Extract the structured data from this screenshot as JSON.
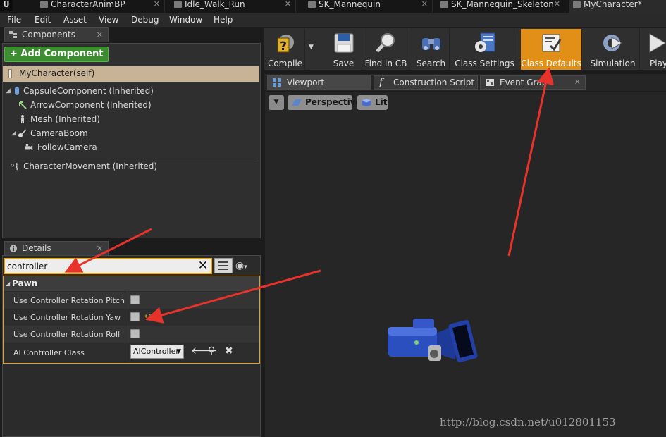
{
  "tabs": [
    {
      "label": "CharacterAnimBP"
    },
    {
      "label": "Idle_Walk_Run"
    },
    {
      "label": "SK_Mannequin"
    },
    {
      "label": "SK_Mannequin_Skeleton"
    },
    {
      "label": "MyCharacter*"
    }
  ],
  "menu": [
    "File",
    "Edit",
    "Asset",
    "View",
    "Debug",
    "Window",
    "Help"
  ],
  "components": {
    "tab_label": "Components",
    "add_button": "+ Add Component ▾",
    "self_item": "MyCharacter(self)",
    "tree": [
      {
        "label": "CapsuleComponent (Inherited)",
        "icon": "capsule-icon"
      },
      {
        "label": "ArrowComponent (Inherited)",
        "icon": "arrow-icon"
      },
      {
        "label": "Mesh (Inherited)",
        "icon": "mesh-icon"
      },
      {
        "label": "CameraBoom",
        "icon": "camera-boom-icon"
      },
      {
        "label": "FollowCamera",
        "icon": "camera-icon"
      },
      {
        "label": "CharacterMovement (Inherited)",
        "icon": "movement-icon"
      }
    ]
  },
  "details": {
    "tab_label": "Details",
    "search_value": "controller",
    "section": "Pawn",
    "properties": [
      {
        "label": "Use Controller Rotation Pitch",
        "checked": false
      },
      {
        "label": "Use Controller Rotation Yaw",
        "checked": false
      },
      {
        "label": "Use Controller Rotation Roll",
        "checked": false
      }
    ],
    "ai_controller": {
      "label": "AI Controller Class",
      "value": "AIController"
    }
  },
  "toolbar": {
    "buttons": [
      {
        "label": "Compile",
        "icon": "compile-icon"
      },
      {
        "label": "Save",
        "icon": "save-icon"
      },
      {
        "label": "Find in CB",
        "icon": "find-icon"
      },
      {
        "label": "Search",
        "icon": "binoculars-icon"
      },
      {
        "label": "Class Settings",
        "icon": "class-settings-icon"
      },
      {
        "label": "Class Defaults",
        "icon": "class-defaults-icon",
        "active": true
      },
      {
        "label": "Simulation",
        "icon": "simulation-icon"
      },
      {
        "label": "Play",
        "icon": "play-icon"
      }
    ]
  },
  "editor_tabs": [
    {
      "label": "Viewport",
      "icon": "grid-icon"
    },
    {
      "label": "Construction Script",
      "icon": "function-icon"
    },
    {
      "label": "Event Grap",
      "icon": "event-graph-icon"
    }
  ],
  "viewport": {
    "perspective": "Perspective",
    "lit": "Lit"
  },
  "watermark": "http://blog.csdn.net/u012801153",
  "colors": {
    "accent_orange": "#e28f17",
    "annotation_red": "#e8322c",
    "add_green": "#3c8d2f",
    "selection_tan": "#c9b396"
  }
}
